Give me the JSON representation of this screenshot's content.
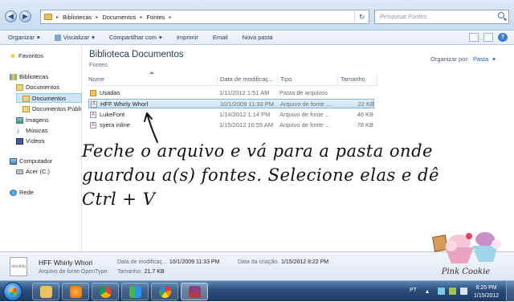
{
  "address": {
    "crumbs": [
      "Bibliotecas",
      "Documentos",
      "Fontes"
    ],
    "search_placeholder": "Pesquisar Fontes"
  },
  "toolbar": {
    "organize": "Organizar",
    "view": "Visualizar",
    "share": "Compartilhar com",
    "print": "Imprimir",
    "email": "Email",
    "new_folder": "Nova pasta"
  },
  "sidebar": {
    "favorites": "Favoritos",
    "libraries": "Bibliotecas",
    "documents": "Documentos",
    "documents_sub": "Documentos",
    "public_documents": "Documentos Públi",
    "images": "Imagens",
    "music": "Músicas",
    "videos": "Vídeos",
    "computer": "Computador",
    "drive": "Acer (C:)",
    "network": "Rede"
  },
  "library": {
    "title": "Biblioteca Documentos",
    "subtitle": "Fontes",
    "arrange_label": "Organizar por:",
    "arrange_value": "Pasta"
  },
  "columns": {
    "name": "Nome",
    "date": "Data de modificaç...",
    "type": "Tipo",
    "size": "Tamanho"
  },
  "files": [
    {
      "name": "Usadas",
      "date": "1/11/2012 1:51 AM",
      "type": "Pasta de arquivos",
      "size": "",
      "icon": "folder-icon",
      "selected": false
    },
    {
      "name": "HFF Whirly Whorl",
      "date": "10/1/2009 11:33 PM",
      "type": "Arquivo de fonte ...",
      "size": "22 KB",
      "icon": "font-file-icon",
      "selected": true
    },
    {
      "name": "LukeFont",
      "date": "1/14/2012 1:14 PM",
      "type": "Arquivo de fonte ...",
      "size": "46 KB",
      "icon": "font-file-icon",
      "selected": false
    },
    {
      "name": "syera inline",
      "date": "1/15/2012 10:55 AM",
      "type": "Arquivo de fonte ...",
      "size": "78 KB",
      "icon": "font-file-icon",
      "selected": false
    }
  ],
  "annotation": {
    "line1": "Feche o arquivo e vá para a pasta onde",
    "line2": "guardou a(s) fontes. Selecione elas e dê",
    "line3": "Ctrl + V"
  },
  "details": {
    "thumb_label": "abcdefg",
    "name": "HFF Whirly Whorl",
    "type": "Arquivo de fonte OpenType",
    "modified_label": "Data de modificaç...",
    "modified_value": "10/1/2009 11:33 PM",
    "created_label": "Data da criação:",
    "created_value": "1/15/2012 8:22 PM",
    "size_label": "Tamanho:",
    "size_value": "21.7 KB"
  },
  "logo_text": "Pink Cookie",
  "taskbar": {
    "lang": "PT",
    "time": "8:25 PM",
    "date": "1/15/2012"
  },
  "colors": {
    "selection": "#c8e2f8",
    "title": "#1e395b",
    "taskbar": "#2a4d7a"
  }
}
